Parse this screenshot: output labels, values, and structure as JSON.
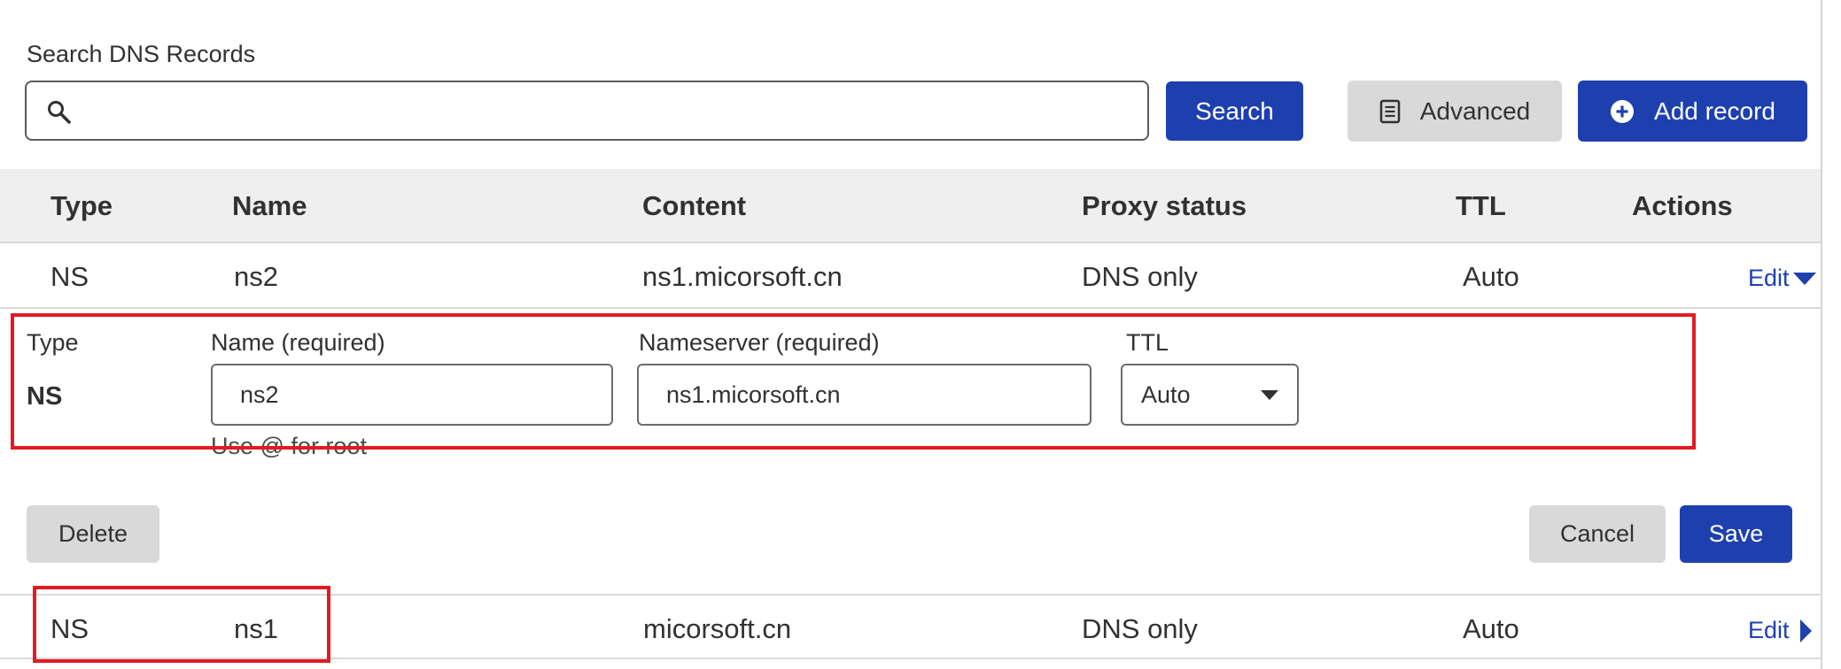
{
  "search": {
    "label": "Search DNS Records",
    "value": "",
    "placeholder": "",
    "button_label": "Search"
  },
  "toolbar": {
    "advanced_label": "Advanced",
    "add_record_label": "Add record"
  },
  "table": {
    "columns": [
      "Type",
      "Name",
      "Content",
      "Proxy status",
      "TTL",
      "Actions"
    ],
    "rows": [
      {
        "type": "NS",
        "name": "ns2",
        "content": "ns1.micorsoft.cn",
        "proxy_status": "DNS only",
        "ttl": "Auto",
        "action": "Edit",
        "expanded": true
      },
      {
        "type": "NS",
        "name": "ns1",
        "content": "micorsoft.cn",
        "proxy_status": "DNS only",
        "ttl": "Auto",
        "action": "Edit",
        "expanded": false
      }
    ]
  },
  "edit_form": {
    "type_label": "Type",
    "type_value": "NS",
    "name_label": "Name (required)",
    "name_value": "ns2",
    "name_hint": "Use @ for root",
    "nameserver_label": "Nameserver (required)",
    "nameserver_value": "ns1.micorsoft.cn",
    "ttl_label": "TTL",
    "ttl_value": "Auto",
    "delete_label": "Delete",
    "cancel_label": "Cancel",
    "save_label": "Save"
  },
  "colors": {
    "primary": "#1e40ae",
    "highlight": "#e11b22",
    "header_bg": "#efefef",
    "gray_button": "#d9d9d9"
  },
  "icons": {
    "search": "magnifier-icon",
    "advanced": "document-icon",
    "add": "plus-circle-icon"
  }
}
